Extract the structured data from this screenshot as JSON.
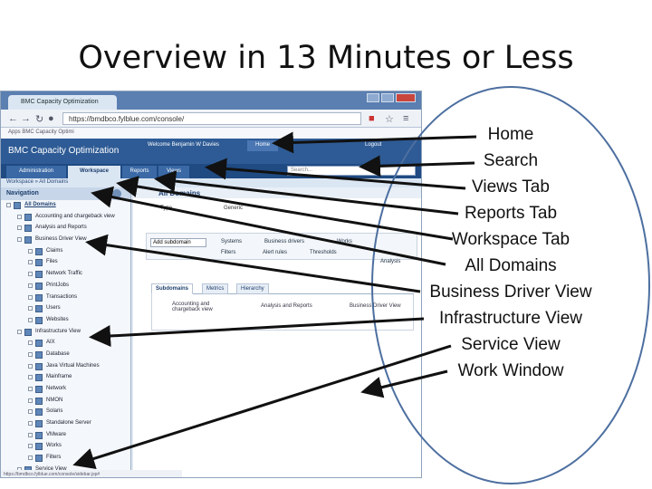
{
  "slide": {
    "title": "Overview in 13 Minutes or Less"
  },
  "browser": {
    "tab_title": "BMC Capacity Optimization",
    "url": "https://bmdbco.fylblue.com/console/",
    "bookmarks": "Apps   BMC Capacity Optimi",
    "status_url": "https://bmdbco.fylblue.com/console/sidebar.jsp#"
  },
  "app": {
    "name": "BMC Capacity Optimization",
    "welcome": "Welcome Benjamin W Davies",
    "home": "Home",
    "logout": "Logout",
    "tabs": [
      "Administration",
      "Workspace",
      "Reports",
      "Views"
    ],
    "search_placeholder": "Search...",
    "breadcrumb": "Workspace » All Domains"
  },
  "navigation": {
    "title": "Navigation",
    "tree": [
      {
        "label": "All Domains",
        "level": 0,
        "bold": true
      },
      {
        "label": "Accounting and chargeback view",
        "level": 1
      },
      {
        "label": "Analysis and Reports",
        "level": 1
      },
      {
        "label": "Business Driver View",
        "level": 1
      },
      {
        "label": "Claims",
        "level": 2
      },
      {
        "label": "Files",
        "level": 2
      },
      {
        "label": "Network Traffic",
        "level": 2
      },
      {
        "label": "PrintJobs",
        "level": 2
      },
      {
        "label": "Transactions",
        "level": 2
      },
      {
        "label": "Users",
        "level": 2
      },
      {
        "label": "Websites",
        "level": 2
      },
      {
        "label": "Infrastructure View",
        "level": 1
      },
      {
        "label": "AIX",
        "level": 2
      },
      {
        "label": "Database",
        "level": 2
      },
      {
        "label": "Java Virtual Machines",
        "level": 2
      },
      {
        "label": "Mainframe",
        "level": 2
      },
      {
        "label": "Network",
        "level": 2
      },
      {
        "label": "NMON",
        "level": 2
      },
      {
        "label": "Solaris",
        "level": 2
      },
      {
        "label": "Standalone Server",
        "level": 2
      },
      {
        "label": "VMware",
        "level": 2
      },
      {
        "label": "Works",
        "level": 2
      },
      {
        "label": "Filters",
        "level": 2
      },
      {
        "label": "Service View",
        "level": 1
      }
    ]
  },
  "work": {
    "title": "All Domains",
    "type_label": "Type",
    "type_value": "Generic",
    "toolbar": {
      "add_domain": "Add subdomain",
      "systems": "Systems",
      "business_drivers": "Business drivers",
      "works": "Works",
      "filters": "Filters",
      "alert_rules": "Alert rules",
      "thresholds": "Thresholds",
      "analysis": "Analysis"
    },
    "subtabs": [
      "Subdomains",
      "Metrics",
      "Hierarchy"
    ],
    "subdomains": [
      "Accounting and chargeback view",
      "Analysis and Reports",
      "Business Driver View"
    ]
  },
  "annotations": [
    "Home",
    "Search",
    "Views Tab",
    "Reports Tab",
    "Workspace Tab",
    "All Domains",
    "Business Driver View",
    "Infrastructure View",
    "Service View",
    "Work Window"
  ],
  "colors": {
    "app_header": "#2e5b95",
    "tab_bar": "#1f4a82",
    "ellipse": "#4d6fa0",
    "arrow": "#111111"
  }
}
